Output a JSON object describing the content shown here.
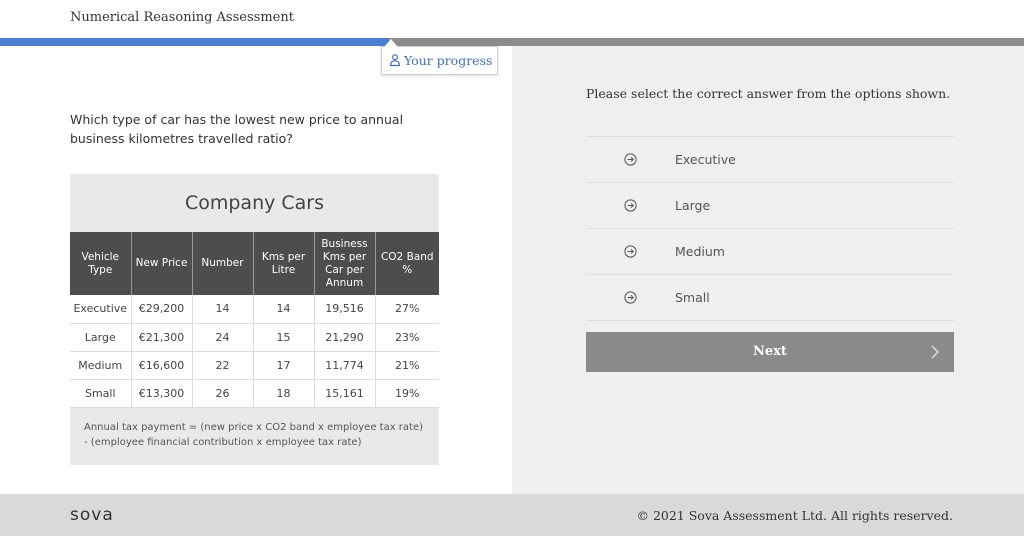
{
  "header": {
    "title": "Numerical Reasoning Assessment"
  },
  "progress": {
    "label": "Your progress",
    "fraction": 0.38
  },
  "question": {
    "text": "Which type of car has the lowest new price to annual business kilometres travelled ratio?"
  },
  "table": {
    "title": "Company Cars",
    "headers": [
      "Vehicle Type",
      "New Price",
      "Number",
      "Kms per Litre",
      "Business Kms per Car per Annum",
      "CO2 Band %"
    ],
    "rows": [
      [
        "Executive",
        "€29,200",
        "14",
        "14",
        "19,516",
        "27%"
      ],
      [
        "Large",
        "€21,300",
        "24",
        "15",
        "21,290",
        "23%"
      ],
      [
        "Medium",
        "€16,600",
        "22",
        "17",
        "11,774",
        "21%"
      ],
      [
        "Small",
        "€13,300",
        "26",
        "18",
        "15,161",
        "19%"
      ]
    ],
    "formula_line1": "Annual tax payment = (new price x CO2 band x employee tax rate)",
    "formula_line2": "- (employee financial contribution x employee tax rate)"
  },
  "answers": {
    "instruction": "Please select the correct answer from the options shown.",
    "options": [
      "Executive",
      "Large",
      "Medium",
      "Small"
    ],
    "option_icon": "arrow-circle-right-icon"
  },
  "next_button": {
    "label": "Next",
    "icon": "chevron-right-icon"
  },
  "footer": {
    "logo": "sova",
    "copyright": "© 2021 Sova Assessment Ltd. All rights reserved."
  },
  "colors": {
    "accent": "#4a7fd4",
    "progress_track": "#8c8c8c",
    "table_header": "#4d4d4d",
    "next_button": "#8a8a8a"
  }
}
